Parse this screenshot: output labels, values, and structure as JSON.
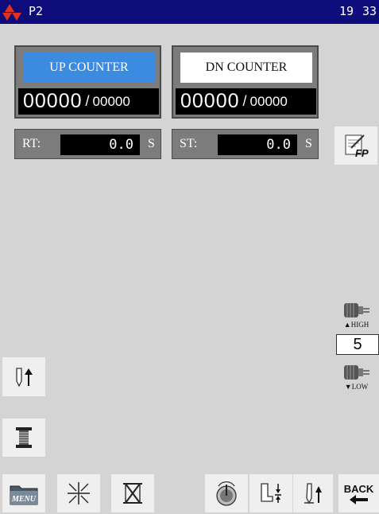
{
  "status_bar": {
    "page": "P2",
    "hour": "19",
    "minute": "33"
  },
  "up_counter": {
    "label": "UP COUNTER",
    "current": "00000",
    "separator": "/",
    "total": "00000"
  },
  "dn_counter": {
    "label": "DN COUNTER",
    "current": "00000",
    "separator": "/",
    "total": "00000"
  },
  "rt_timer": {
    "label": "RT:",
    "value": "0.0",
    "unit": "S"
  },
  "st_timer": {
    "label": "ST:",
    "value": "0.0",
    "unit": "S"
  },
  "fp_button": {
    "label": "FP"
  },
  "speed": {
    "high_label": "HIGH",
    "value": "5",
    "low_label": "LOW"
  },
  "toolbar": {
    "menu_label": "MENU",
    "back_label": "BACK"
  },
  "colors": {
    "title_bar": "#0e0c7a",
    "up_counter_active": "#3b8be0",
    "background": "#d4d4d4",
    "logo": "#e03020"
  }
}
